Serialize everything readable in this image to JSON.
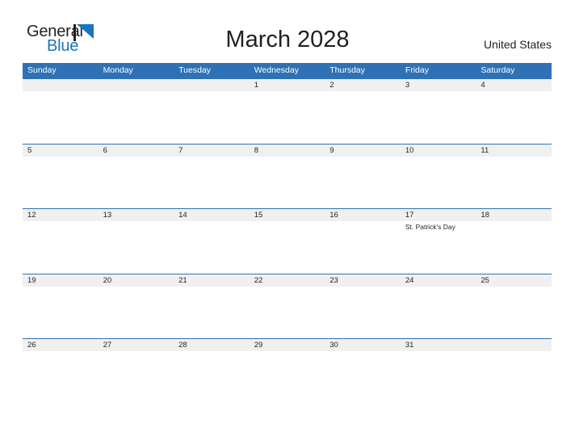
{
  "brand": {
    "name_part1": "General",
    "name_part2": "Blue",
    "flag_color": "#1b75bb"
  },
  "header": {
    "title": "March 2028",
    "region": "United States"
  },
  "calendar": {
    "month": "March",
    "year": "2028",
    "header_bg": "#2e71b4",
    "band_bg": "#f0f0f0",
    "weekdays": [
      "Sunday",
      "Monday",
      "Tuesday",
      "Wednesday",
      "Thursday",
      "Friday",
      "Saturday"
    ],
    "weeks": [
      {
        "days": [
          {
            "date": "",
            "event": ""
          },
          {
            "date": "",
            "event": ""
          },
          {
            "date": "",
            "event": ""
          },
          {
            "date": "1",
            "event": ""
          },
          {
            "date": "2",
            "event": ""
          },
          {
            "date": "3",
            "event": ""
          },
          {
            "date": "4",
            "event": ""
          }
        ]
      },
      {
        "days": [
          {
            "date": "5",
            "event": ""
          },
          {
            "date": "6",
            "event": ""
          },
          {
            "date": "7",
            "event": ""
          },
          {
            "date": "8",
            "event": ""
          },
          {
            "date": "9",
            "event": ""
          },
          {
            "date": "10",
            "event": ""
          },
          {
            "date": "11",
            "event": ""
          }
        ]
      },
      {
        "days": [
          {
            "date": "12",
            "event": ""
          },
          {
            "date": "13",
            "event": ""
          },
          {
            "date": "14",
            "event": ""
          },
          {
            "date": "15",
            "event": ""
          },
          {
            "date": "16",
            "event": ""
          },
          {
            "date": "17",
            "event": "St. Patrick's Day"
          },
          {
            "date": "18",
            "event": ""
          }
        ]
      },
      {
        "days": [
          {
            "date": "19",
            "event": ""
          },
          {
            "date": "20",
            "event": ""
          },
          {
            "date": "21",
            "event": ""
          },
          {
            "date": "22",
            "event": ""
          },
          {
            "date": "23",
            "event": ""
          },
          {
            "date": "24",
            "event": ""
          },
          {
            "date": "25",
            "event": ""
          }
        ]
      },
      {
        "days": [
          {
            "date": "26",
            "event": ""
          },
          {
            "date": "27",
            "event": ""
          },
          {
            "date": "28",
            "event": ""
          },
          {
            "date": "29",
            "event": ""
          },
          {
            "date": "30",
            "event": ""
          },
          {
            "date": "31",
            "event": ""
          },
          {
            "date": "",
            "event": ""
          }
        ]
      }
    ]
  }
}
